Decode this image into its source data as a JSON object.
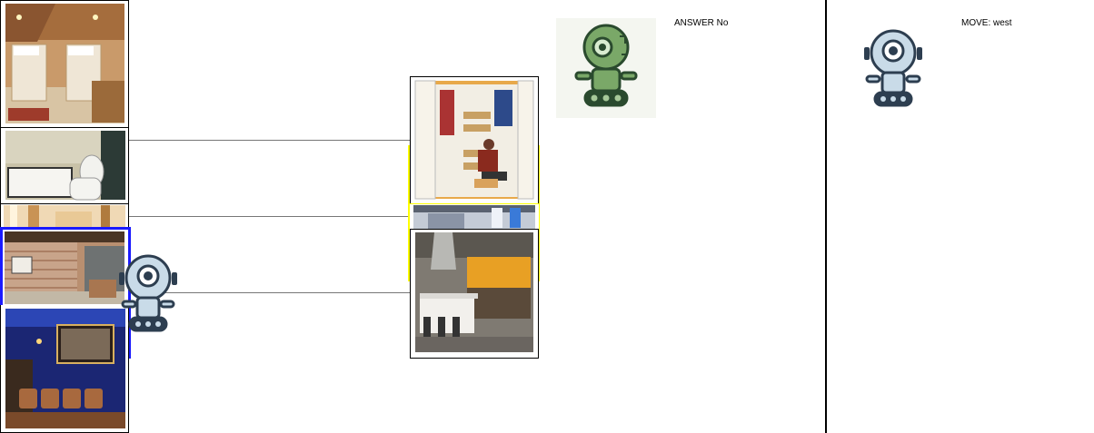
{
  "answer_panel": {
    "text": "ANSWER No",
    "robot_icon": "green-robot-icon"
  },
  "move_panel": {
    "text": "MOVE: west",
    "robot_icon": "blue-robot-icon"
  },
  "map": {
    "left_rooms": [
      {
        "name": "bedroom-room-tile"
      },
      {
        "name": "bathroom-room-tile"
      },
      {
        "name": "hallway-room-tile"
      },
      {
        "name": "basement-room-tile"
      },
      {
        "name": "home-theater-room-tile"
      }
    ],
    "right_rooms": [
      {
        "name": "closet-room-tile"
      },
      {
        "name": "corridor-room-tile"
      },
      {
        "name": "kitchen-room-tile"
      }
    ],
    "agent_icon": "blue-robot-icon",
    "highlight_color": "#1a1aff",
    "target_highlight_color": "#ffff00"
  }
}
